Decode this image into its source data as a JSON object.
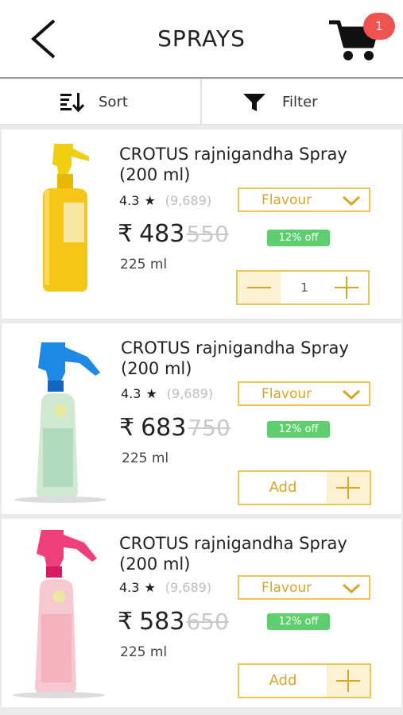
{
  "header": {
    "title": "SPRAYS",
    "cart_count": "1"
  },
  "toolbar": {
    "sort_label": "Sort",
    "filter_label": "Filter"
  },
  "products": [
    {
      "name_line1": "CROTUS rajnigandha Spray",
      "name_line2": "(200 ml)",
      "rating": "4.3",
      "rating_count": "(9,689)",
      "flavour_label": "Flavour",
      "currency": "₹",
      "price": "483",
      "mrp": "550",
      "discount": "12% off",
      "size": "225 ml",
      "quantity": "1",
      "bottle_color": "#f5c518",
      "nozzle_color": "#f3d000"
    },
    {
      "name_line1": "CROTUS rajnigandha Spray",
      "name_line2": "(200 ml)",
      "rating": "4.3",
      "rating_count": "(9,689)",
      "flavour_label": "Flavour",
      "currency": "₹",
      "price": "683",
      "mrp": "750",
      "discount": "12% off",
      "size": "225 ml",
      "add_label": "Add",
      "bottle_color": "#cfe9d2",
      "nozzle_color": "#1e88e5"
    },
    {
      "name_line1": "CROTUS rajnigandha Spray",
      "name_line2": "(200 ml)",
      "rating": "4.3",
      "rating_count": "(9,689)",
      "flavour_label": "Flavour",
      "currency": "₹",
      "price": "583",
      "mrp": "650",
      "discount": "12% off",
      "size": "225 ml",
      "add_label": "Add",
      "bottle_color": "#f6c9d1",
      "nozzle_color": "#ef3f7a"
    }
  ],
  "colors": {
    "accent": "#e8c65a",
    "discount": "#5fce6e",
    "badge": "#ef5350"
  }
}
